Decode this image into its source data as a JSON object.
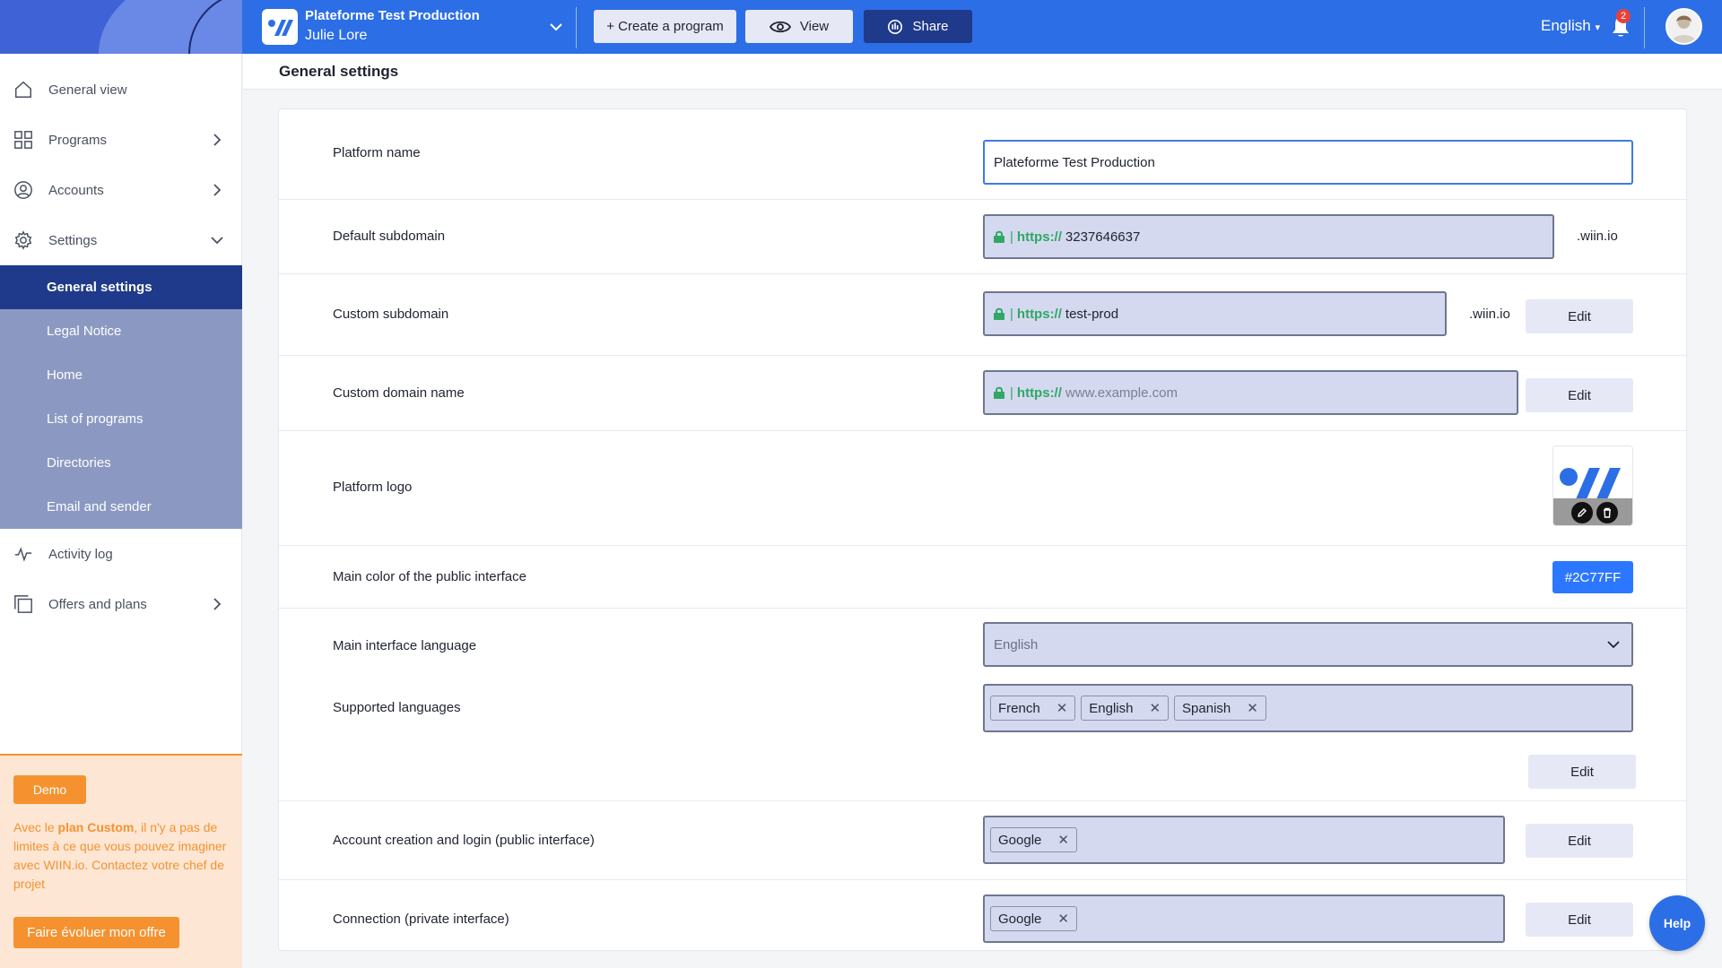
{
  "topbar": {
    "platform_name": "Plateforme Test Production",
    "user_name": "Julie Lore",
    "create_label": "+ Create a program",
    "view_label": "View",
    "share_label": "Share",
    "language": "English",
    "notification_count": "2"
  },
  "sidebar": {
    "items": [
      {
        "label": "General view",
        "icon": "home-icon"
      },
      {
        "label": "Programs",
        "icon": "grid-icon"
      },
      {
        "label": "Accounts",
        "icon": "user-circle-icon"
      },
      {
        "label": "Settings",
        "icon": "gear-icon"
      }
    ],
    "settings_sub": [
      {
        "label": "General settings",
        "active": true
      },
      {
        "label": "Legal Notice"
      },
      {
        "label": "Home"
      },
      {
        "label": "List of programs"
      },
      {
        "label": "Directories"
      },
      {
        "label": "Email and sender"
      }
    ],
    "bottom_items": [
      {
        "label": "Activity log",
        "icon": "activity-icon"
      },
      {
        "label": "Offers and plans",
        "icon": "copy-icon"
      }
    ]
  },
  "promo": {
    "badge": "Demo",
    "text_before": "Avec le ",
    "text_bold": "plan Custom",
    "text_after": ", il n'y a pas de limites à ce que vous pouvez imaginer avec WIIN.io. Contactez votre chef de projet",
    "button": "Faire évoluer mon offre"
  },
  "page": {
    "title": "General settings"
  },
  "settings": {
    "platform_name": {
      "label": "Platform name",
      "value": "Plateforme Test Production"
    },
    "default_subdomain": {
      "label": "Default subdomain",
      "protocol": "https://",
      "value": "3237646637",
      "suffix": ".wiin.io"
    },
    "custom_subdomain": {
      "label": "Custom subdomain",
      "protocol": "https://",
      "value": "test-prod",
      "suffix": ".wiin.io",
      "edit": "Edit"
    },
    "custom_domain": {
      "label": "Custom domain name",
      "protocol": "https://",
      "placeholder": "www.example.com",
      "edit": "Edit"
    },
    "platform_logo": {
      "label": "Platform logo"
    },
    "main_color": {
      "label": "Main color of the public interface",
      "value": "#2C77FF"
    },
    "main_language": {
      "label": "Main interface language",
      "value": "English"
    },
    "supported_languages": {
      "label": "Supported languages",
      "chips": [
        "French",
        "English",
        "Spanish"
      ],
      "edit": "Edit"
    },
    "account_creation": {
      "label": "Account creation and login (public interface)",
      "chips": [
        "Google"
      ],
      "edit": "Edit"
    },
    "connection": {
      "label": "Connection (private interface)",
      "chips": [
        "Google"
      ],
      "edit": "Edit"
    }
  },
  "help": {
    "label": "Help"
  },
  "colors": {
    "primary": "#2c6ee6",
    "dark": "#1f3a8a",
    "accent": "#f5922f",
    "success": "#2fa866"
  }
}
